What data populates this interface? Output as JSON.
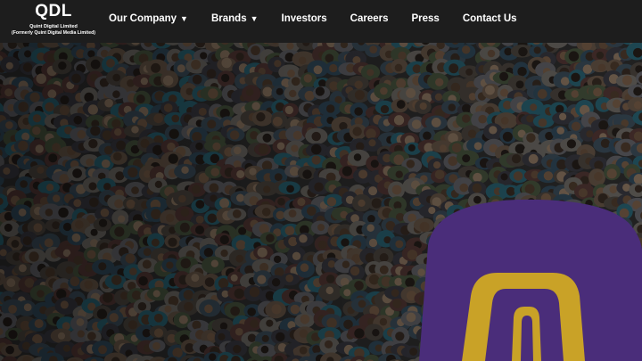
{
  "header": {
    "logo": {
      "mark": "QDL",
      "company": "Quint Digital Limited",
      "former_name": "(Formerly Quint Digital Media Limited)"
    },
    "nav": [
      {
        "label": "Our Company",
        "dropdown": true
      },
      {
        "label": "Brands",
        "dropdown": true
      },
      {
        "label": "Investors",
        "dropdown": false
      },
      {
        "label": "Careers",
        "dropdown": false
      },
      {
        "label": "Press",
        "dropdown": false
      },
      {
        "label": "Contact Us",
        "dropdown": false
      }
    ],
    "caret_glyph": "▼"
  },
  "hero": {
    "image": "aerial-crowd-photo",
    "mic_tag_color": "#4a2d7a",
    "mic_tag_accent": "#c9a227"
  },
  "colors": {
    "header_bg": "#1d1d1d",
    "text": "#ffffff"
  }
}
